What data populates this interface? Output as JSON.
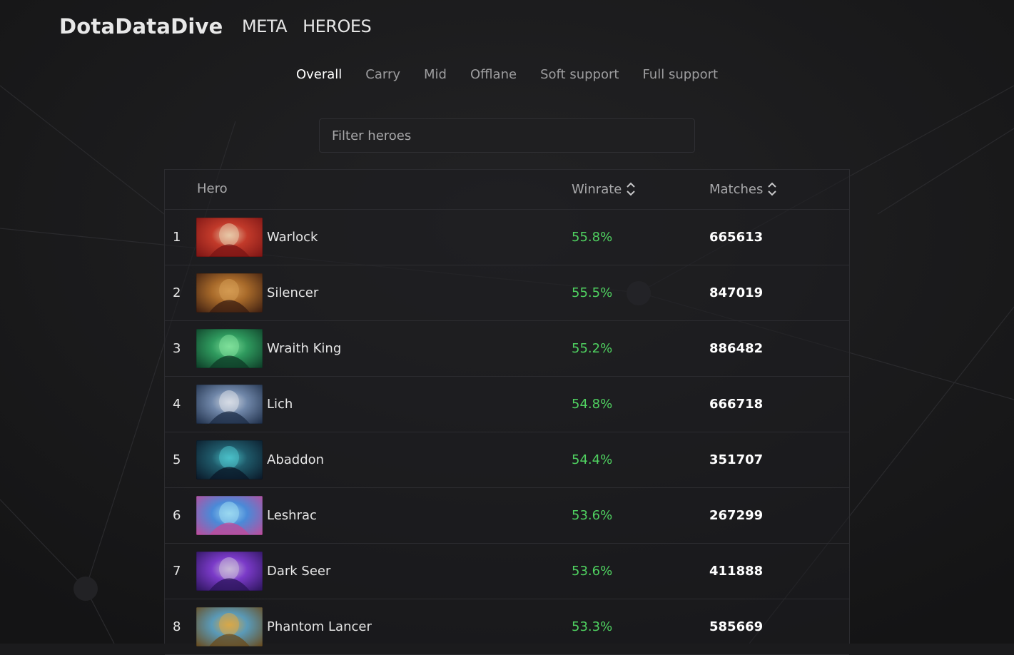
{
  "brand": "DotaDataDive",
  "nav": [
    {
      "label": "META"
    },
    {
      "label": "HEROES"
    }
  ],
  "tabs": [
    {
      "label": "Overall",
      "active": true
    },
    {
      "label": "Carry"
    },
    {
      "label": "Mid"
    },
    {
      "label": "Offlane"
    },
    {
      "label": "Soft support"
    },
    {
      "label": "Full support"
    }
  ],
  "filter": {
    "placeholder": "Filter heroes",
    "value": ""
  },
  "table": {
    "columns": {
      "hero": "Hero",
      "winrate": "Winrate",
      "matches": "Matches"
    },
    "rows": [
      {
        "rank": "1",
        "hero": "Warlock",
        "winrate": "55.8%",
        "matches": "665613",
        "colors": [
          "#7a1414",
          "#c23a2a",
          "#e8c9a8"
        ],
        "icon": "warlock-portrait-icon"
      },
      {
        "rank": "2",
        "hero": "Silencer",
        "winrate": "55.5%",
        "matches": "847019",
        "colors": [
          "#3a1c10",
          "#a86a2a",
          "#d49a52"
        ],
        "icon": "silencer-portrait-icon"
      },
      {
        "rank": "3",
        "hero": "Wraith King",
        "winrate": "55.2%",
        "matches": "886482",
        "colors": [
          "#0d3a26",
          "#2f9a5e",
          "#7fe09a"
        ],
        "icon": "wraith-king-portrait-icon"
      },
      {
        "rank": "4",
        "hero": "Lich",
        "winrate": "54.8%",
        "matches": "666718",
        "colors": [
          "#1c2c46",
          "#6f86a8",
          "#d7dde6"
        ],
        "icon": "lich-portrait-icon"
      },
      {
        "rank": "5",
        "hero": "Abaddon",
        "winrate": "54.4%",
        "matches": "351707",
        "colors": [
          "#0a1626",
          "#1f5a6a",
          "#4ac0c8"
        ],
        "icon": "abaddon-portrait-icon"
      },
      {
        "rank": "6",
        "hero": "Leshrac",
        "winrate": "53.6%",
        "matches": "267299",
        "colors": [
          "#c24a9a",
          "#4a8ad8",
          "#9ad8f0"
        ],
        "icon": "leshrac-portrait-icon"
      },
      {
        "rank": "7",
        "hero": "Dark Seer",
        "winrate": "53.6%",
        "matches": "411888",
        "colors": [
          "#2a1458",
          "#7a3ac8",
          "#c8b8d8"
        ],
        "icon": "dark-seer-portrait-icon"
      },
      {
        "rank": "8",
        "hero": "Phantom Lancer",
        "winrate": "53.3%",
        "matches": "585669",
        "colors": [
          "#6a4a1a",
          "#5a9ab8",
          "#d8a848"
        ],
        "icon": "phantom-lancer-portrait-icon"
      }
    ]
  },
  "colors": {
    "accent_green": "#4fd160",
    "background": "#1b1b1d"
  }
}
